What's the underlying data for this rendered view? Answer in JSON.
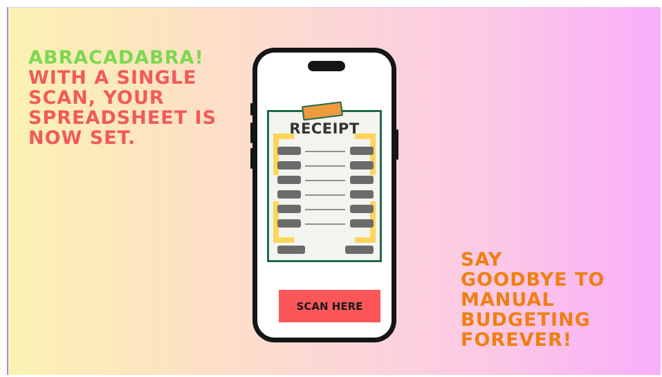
{
  "headline": {
    "line1": "ABRACADABRA!",
    "line2": "WITH A SINGLE\nSCAN, YOUR\nSPREADSHEET IS\nNOW SET."
  },
  "tagline": "SAY\nGOODBYE TO\nMANUAL\nBUDGETING\nFOREVER!",
  "receipt": {
    "title": "RECEIPT"
  },
  "scan_button": {
    "label": "SCAN HERE"
  },
  "colors": {
    "green": "#7cd84f",
    "red": "#f25a5a",
    "orange": "#f07f10",
    "button": "#fb5758",
    "receipt_border": "#1f6b47",
    "highlight": "#fbd65a"
  }
}
